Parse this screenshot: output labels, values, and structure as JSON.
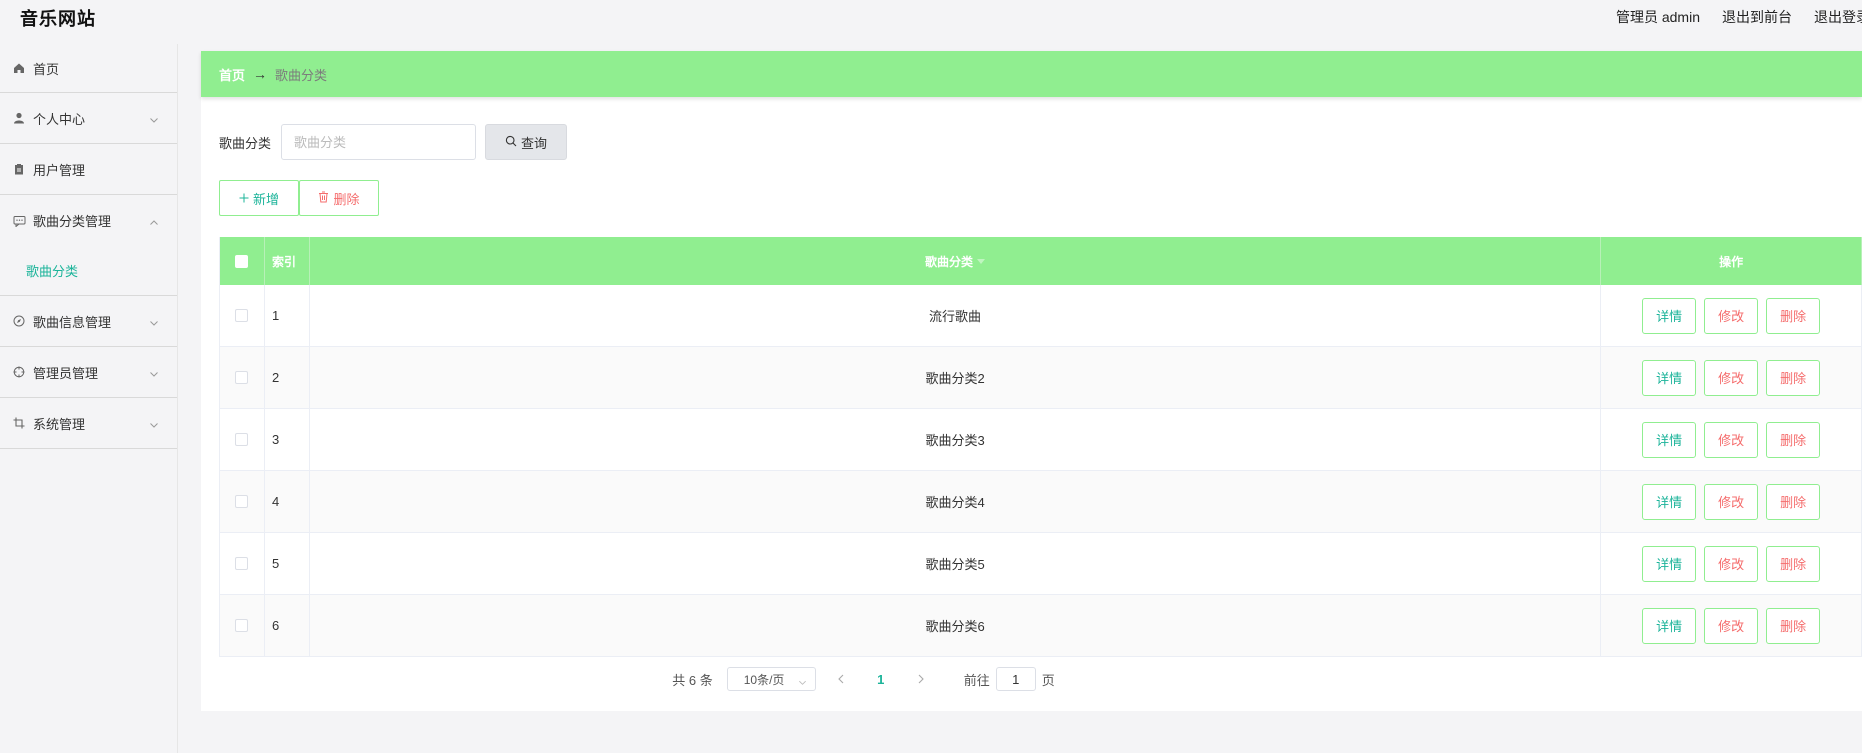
{
  "header": {
    "site_title": "音乐网站",
    "admin_label": "管理员 admin",
    "exit_front": "退出到前台",
    "logout": "退出登录"
  },
  "sidebar": {
    "items": [
      {
        "label": "首页",
        "icon": "home-icon"
      },
      {
        "label": "个人中心",
        "icon": "user-icon"
      },
      {
        "label": "用户管理",
        "icon": "clipboard-icon"
      },
      {
        "label": "歌曲分类管理",
        "icon": "chat-icon"
      },
      {
        "label": "歌曲信息管理",
        "icon": "compass-icon"
      },
      {
        "label": "管理员管理",
        "icon": "target-icon"
      },
      {
        "label": "系统管理",
        "icon": "crop-icon"
      }
    ],
    "sub_active": "歌曲分类"
  },
  "breadcrumb": {
    "home": "首页",
    "arrow": "→",
    "current": "歌曲分类"
  },
  "search": {
    "label": "歌曲分类",
    "placeholder": "歌曲分类",
    "value": "",
    "button": "查询"
  },
  "actions": {
    "add": "新增",
    "delete": "删除"
  },
  "table": {
    "headers": {
      "index": "索引",
      "name": "歌曲分类",
      "ops": "操作"
    },
    "rows": [
      {
        "index": "1",
        "name": "流行歌曲"
      },
      {
        "index": "2",
        "name": "歌曲分类2"
      },
      {
        "index": "3",
        "name": "歌曲分类3"
      },
      {
        "index": "4",
        "name": "歌曲分类4"
      },
      {
        "index": "5",
        "name": "歌曲分类5"
      },
      {
        "index": "6",
        "name": "歌曲分类6"
      }
    ],
    "op_labels": {
      "detail": "详情",
      "edit": "修改",
      "delete": "删除"
    }
  },
  "pagination": {
    "total": "共 6 条",
    "page_size": "10条/页",
    "current_page": "1",
    "goto_prefix": "前往",
    "goto_value": "1",
    "goto_suffix": "页"
  },
  "colors": {
    "accent_green": "#90ee90",
    "teal": "#1cb49a",
    "danger": "#f56c6c"
  }
}
